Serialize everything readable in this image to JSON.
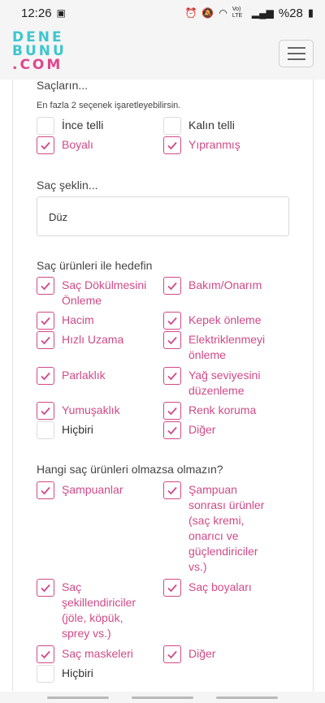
{
  "status_bar": {
    "time": "12:26",
    "battery": "%28",
    "network": "Vo) LTE"
  },
  "logo": {
    "line1": "DENE",
    "line2": "BUNU",
    "line3": ".COM"
  },
  "hair_type": {
    "title": "Saçların...",
    "hint": "En fazla 2 seçenek işaretleyebilirsin.",
    "options": [
      {
        "label": "İnce telli",
        "checked": false
      },
      {
        "label": "Kalın telli",
        "checked": false
      },
      {
        "label": "Boyalı",
        "checked": true
      },
      {
        "label": "Yıpranmış",
        "checked": true
      }
    ]
  },
  "hair_shape": {
    "title": "Saç şeklin...",
    "value": "Düz"
  },
  "goals": {
    "title": "Saç ürünleri ile hedefin",
    "options": [
      {
        "label": "Saç Dökülmesini Önleme",
        "checked": true
      },
      {
        "label": "Bakım/Onarım",
        "checked": true
      },
      {
        "label": "Hacim",
        "checked": true
      },
      {
        "label": "Kepek önleme",
        "checked": true
      },
      {
        "label": "Hızlı Uzama",
        "checked": true
      },
      {
        "label": "Elektriklenmeyi önleme",
        "checked": true
      },
      {
        "label": "Parlaklık",
        "checked": true
      },
      {
        "label": "Yağ seviyesini düzenleme",
        "checked": true
      },
      {
        "label": "Yumuşaklık",
        "checked": true
      },
      {
        "label": "Renk koruma",
        "checked": true
      },
      {
        "label": "Hiçbiri",
        "checked": false
      },
      {
        "label": "Diğer",
        "checked": true
      }
    ]
  },
  "must_haves": {
    "title": "Hangi saç ürünleri olmazsa olmazın?",
    "options": [
      {
        "label": "Şampuanlar",
        "checked": true
      },
      {
        "label": "Şampuan sonrası ürünler (saç kremi, onarıcı ve güçlendiriciler vs.)",
        "checked": true
      },
      {
        "label": "Saç şekillendiriciler (jöle, köpük, sprey vs.)",
        "checked": true
      },
      {
        "label": "Saç boyaları",
        "checked": true
      },
      {
        "label": "Saç maskeleri",
        "checked": true
      },
      {
        "label": "Diğer",
        "checked": true
      },
      {
        "label": "Hiçbiri",
        "checked": false
      }
    ]
  },
  "colors": {
    "accent": "#d04a87",
    "logo_teal": "#3cc6d0",
    "logo_pink": "#e0468c"
  }
}
